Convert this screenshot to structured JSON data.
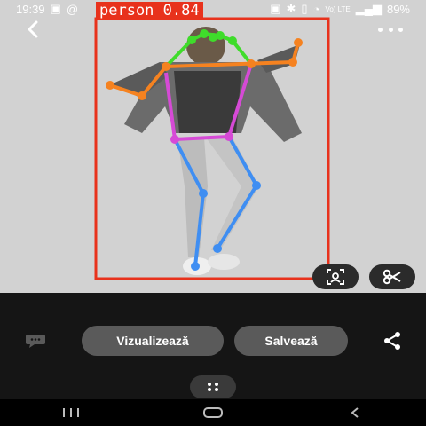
{
  "status_bar": {
    "time": "19:39",
    "battery_percent": "89%",
    "network_label": "Vo) LTE"
  },
  "detection": {
    "label": "person 0.84",
    "box_color": "#e8321c"
  },
  "skeleton_colors": {
    "head": "#3fdc2b",
    "shoulders_arms": "#f58220",
    "torso": "#d64ad6",
    "legs": "#3f8ef2"
  },
  "toolbar": {
    "back_icon": "chevron-left-icon",
    "more_icon": "more-horizontal-icon",
    "scan_icon": "scan-face-icon",
    "cut_icon": "scissors-icon"
  },
  "actions": {
    "view_label": "Vizualizează",
    "save_label": "Salvează",
    "comment_icon": "comment-icon",
    "share_icon": "share-icon",
    "menu_icon": "dots-menu-icon"
  },
  "nav": {
    "recents_icon": "recents-icon",
    "home_icon": "home-icon",
    "back_icon": "back-triangle-icon"
  }
}
